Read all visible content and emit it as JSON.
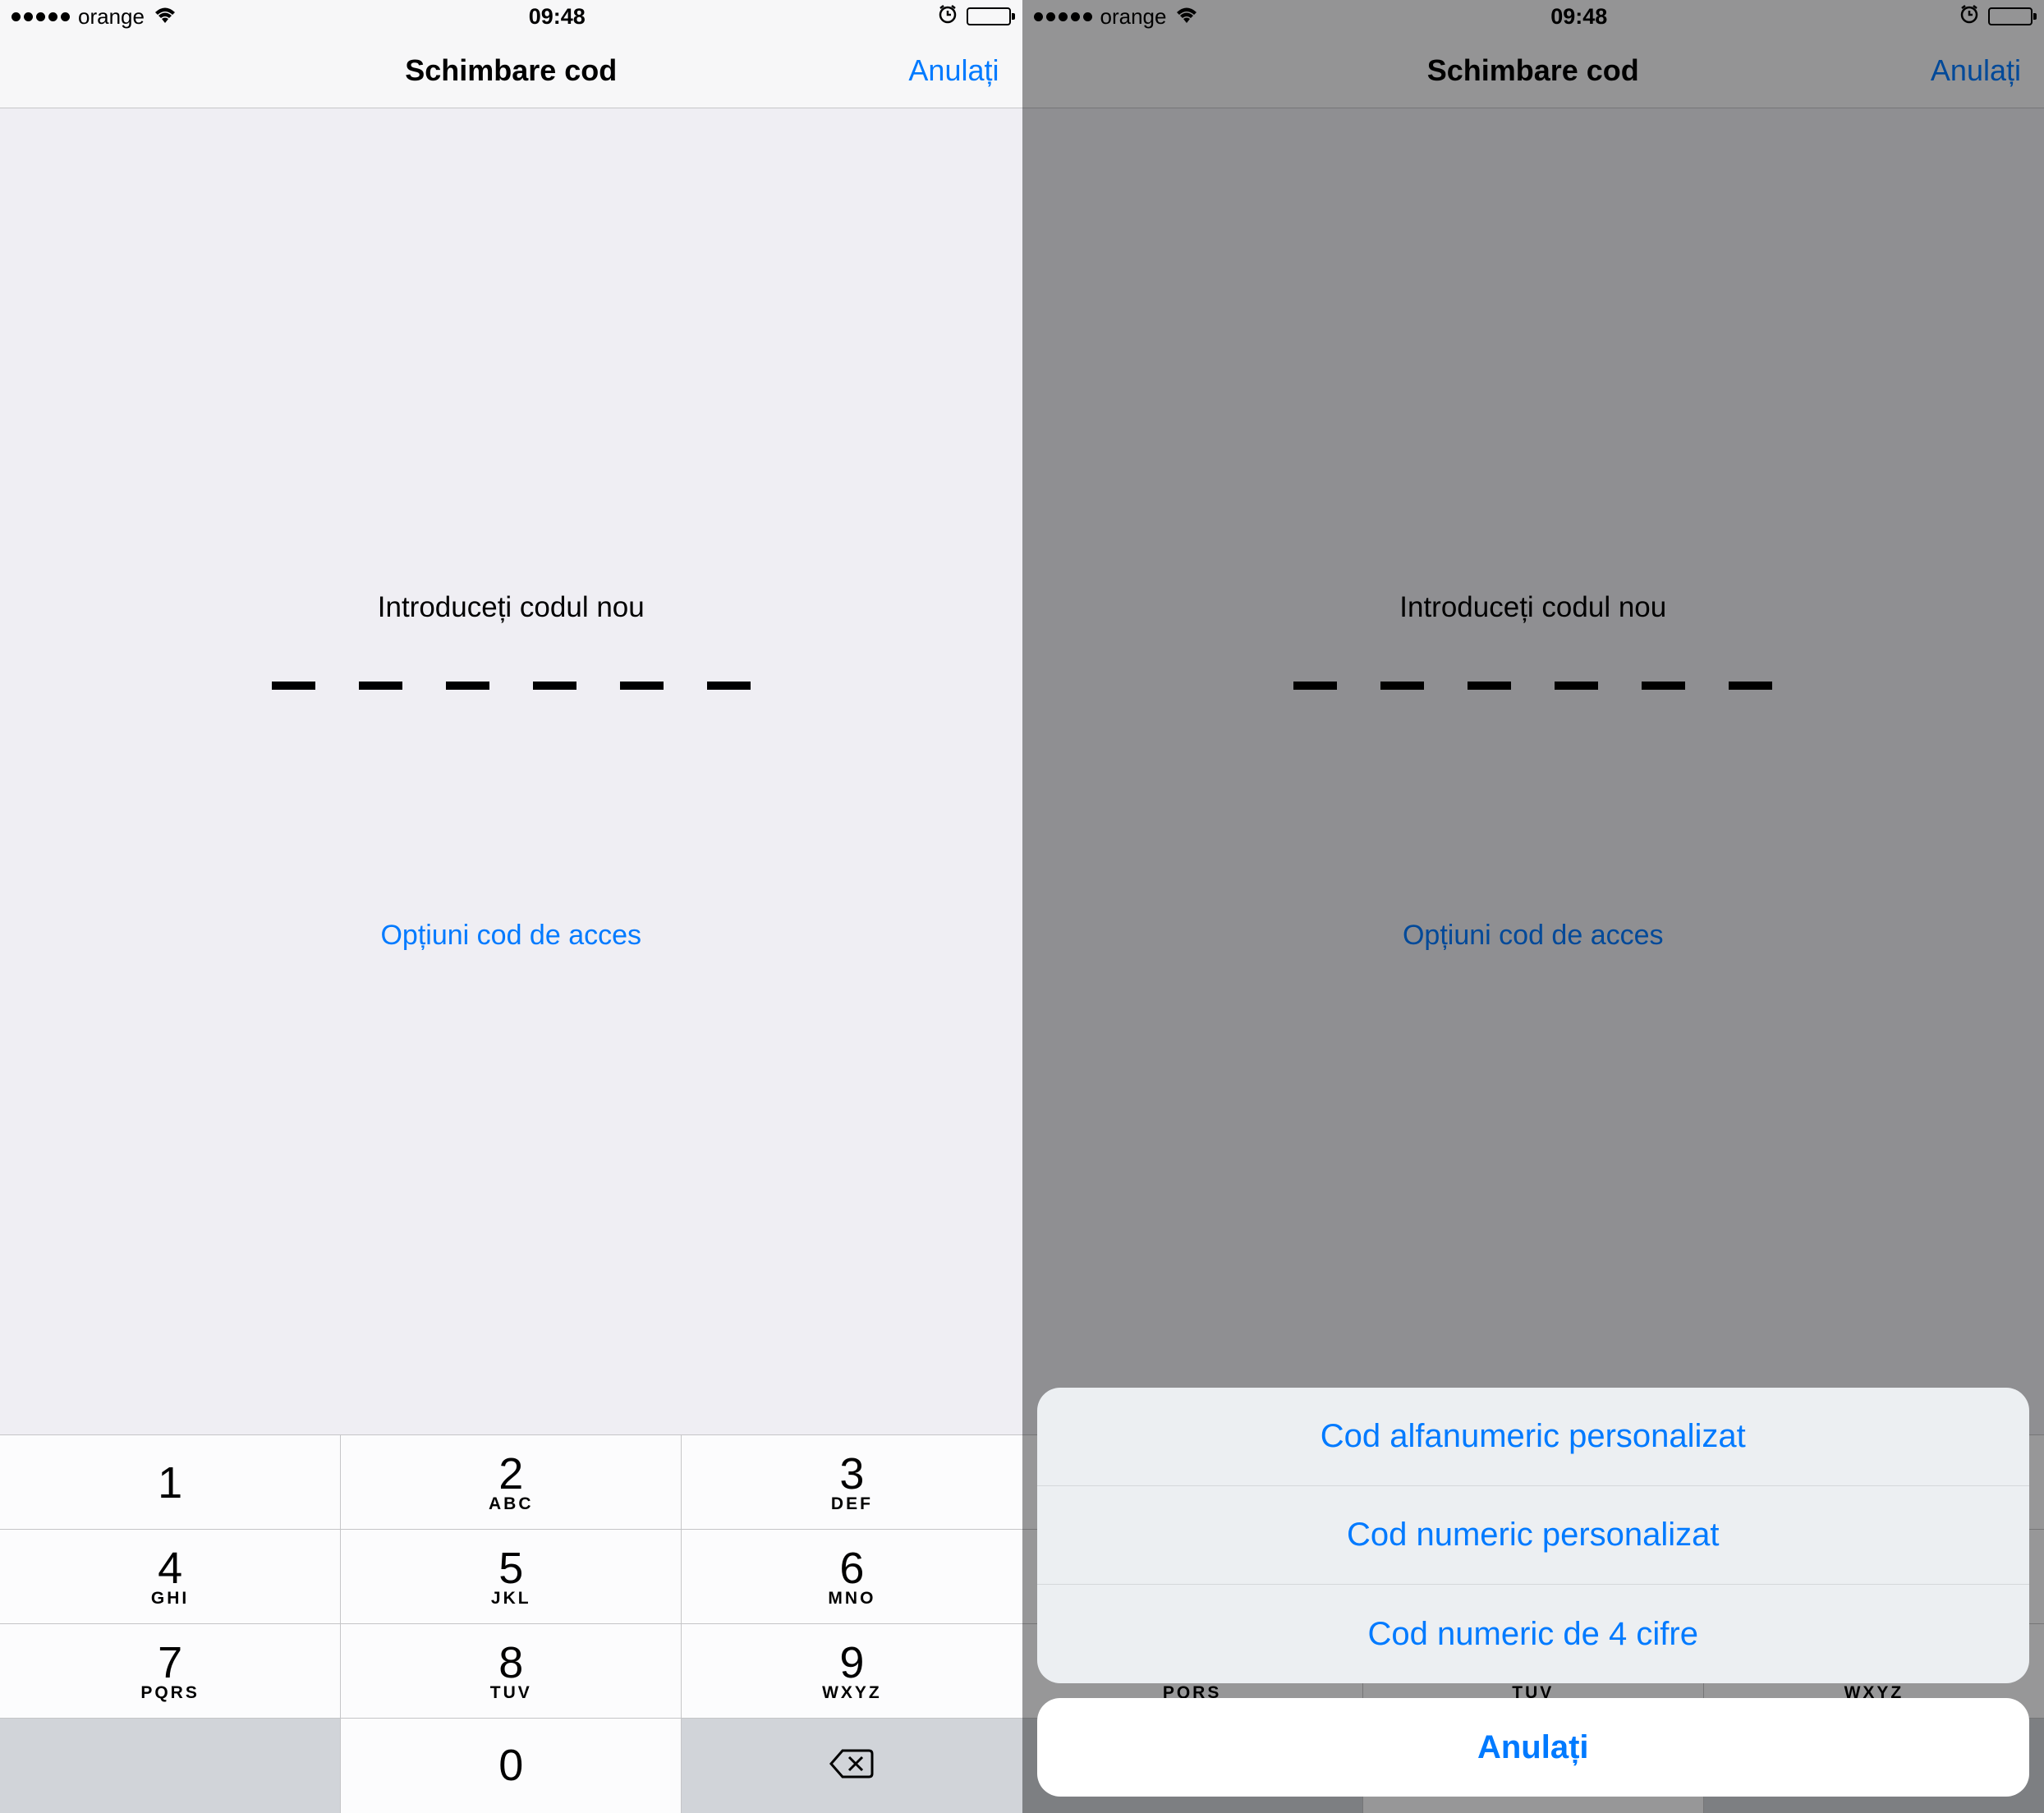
{
  "status": {
    "carrier": "orange",
    "time": "09:48"
  },
  "nav": {
    "title": "Schimbare cod",
    "cancel": "Anulați"
  },
  "body": {
    "prompt": "Introduceți codul nou",
    "options": "Opțiuni cod de acces"
  },
  "keypad": {
    "k1": {
      "d": "1",
      "l": ""
    },
    "k2": {
      "d": "2",
      "l": "ABC"
    },
    "k3": {
      "d": "3",
      "l": "DEF"
    },
    "k4": {
      "d": "4",
      "l": "GHI"
    },
    "k5": {
      "d": "5",
      "l": "JKL"
    },
    "k6": {
      "d": "6",
      "l": "MNO"
    },
    "k7": {
      "d": "7",
      "l": "PQRS"
    },
    "k8": {
      "d": "8",
      "l": "TUV"
    },
    "k9": {
      "d": "9",
      "l": "WXYZ"
    },
    "k0": {
      "d": "0",
      "l": ""
    }
  },
  "sheet": {
    "opt1": "Cod alfanumeric personalizat",
    "opt2": "Cod numeric personalizat",
    "opt3": "Cod numeric de 4 cifre",
    "cancel": "Anulați"
  }
}
